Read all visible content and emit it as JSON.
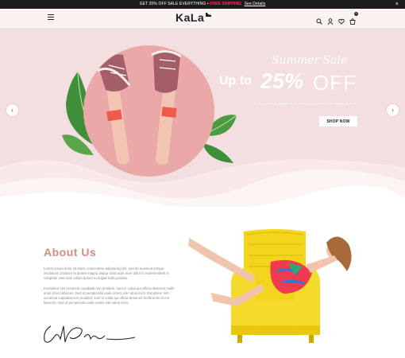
{
  "announcement": {
    "text_a": "GET 20% OFF SALE EVERYTHING",
    "separator": "•",
    "text_b": "FREE SHIPPING",
    "link": "See Details",
    "close": "×"
  },
  "header": {
    "logo": "KaLa",
    "cart_count": "0",
    "icons": [
      "menu-icon",
      "search-icon",
      "user-icon",
      "heart-icon",
      "cart-icon"
    ]
  },
  "hero": {
    "script_title": "Summer Sale",
    "up_to": "Up to",
    "percent": "25%",
    "off": "OFF",
    "button": "SHOP NOW",
    "prev": "‹",
    "next": "›",
    "background": "#f3dfe0",
    "circle_color": "#eaa9a8"
  },
  "about": {
    "title": "About Us",
    "paragraph_1": "Lorem ipsum dolor sit amet, consectetur adipisicing elit, sed do eiusmod tempor incididunt ut labore et dolore magna aliqua. Duis aute irure dolor in reprehenderit in voluptate velit esse cillum dolore eu fugiat nulla pariatur.",
    "paragraph_2": "Excepteur sint occaecat cupidatat non proident, sunt in culpa qui officia deserunt mollit anim id est laborum. Sed ut perspiciatis unde omnis iste natus error. Excepteur sint occaecat cupidatat non proident, sunt in culpa qui officia deserunt mollit anim id est laborum. Sed ut perspiciatis unde omnis iste natus error.",
    "accent": "#d98a83"
  }
}
